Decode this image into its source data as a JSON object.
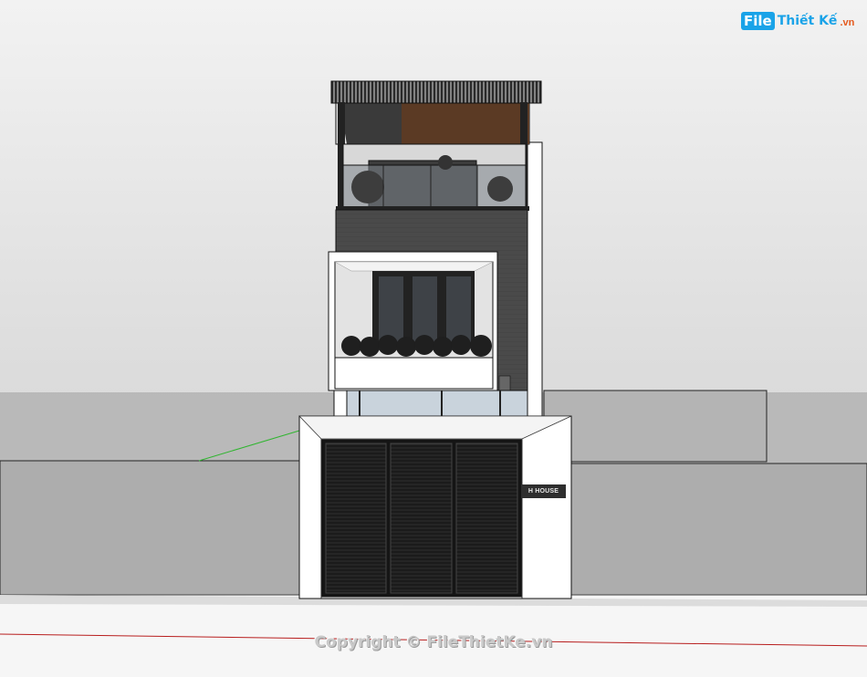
{
  "watermark": {
    "logo_box": "File",
    "logo_text": "Thiết Kế",
    "logo_ext": ".vn",
    "copyright": "Copyright © FileThietKe.vn"
  },
  "building": {
    "name_plate": "H HOUSE"
  },
  "colors": {
    "sky": "#dcdcdc",
    "ground": "#b3b3b3",
    "brick_dark": "#4a4a4a",
    "wall_white": "#ffffff",
    "glass": "#c9d3dc",
    "gate_dark": "#1e1e1e",
    "wood_ceiling": "#5b3a24",
    "brand_blue": "#1aa3e8"
  }
}
